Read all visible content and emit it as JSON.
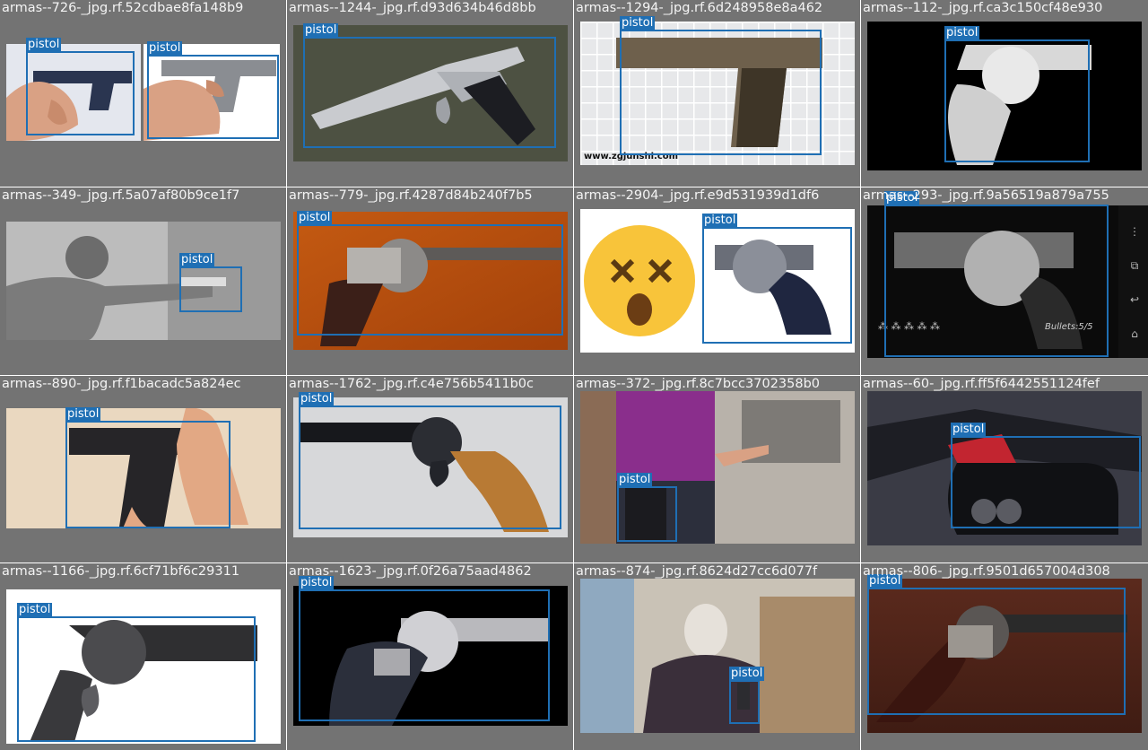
{
  "colors": {
    "tile_background": "#737373",
    "bbox": "#1f6fb4",
    "label_text": "#ffffff",
    "title_text": "#f4f4f4"
  },
  "tiles": [
    {
      "title": "armas--726-_jpg.rf.52cdbae8fa148b9",
      "labels": [
        "pistol",
        "pistol"
      ]
    },
    {
      "title": "armas--1244-_jpg.rf.d93d634b46d8bb",
      "labels": [
        "pistol"
      ]
    },
    {
      "title": "armas--1294-_jpg.rf.6d248958e8a462",
      "labels": [
        "pistol"
      ],
      "watermark": "www.zgjunshi.com"
    },
    {
      "title": "armas--112-_jpg.rf.ca3c150cf48e930",
      "labels": [
        "pistol"
      ]
    },
    {
      "title": "armas--349-_jpg.rf.5a07af80b9ce1f7",
      "labels": [
        "pistol"
      ]
    },
    {
      "title": "armas--779-_jpg.rf.4287d84b240f7b5",
      "labels": [
        "pistol"
      ]
    },
    {
      "title": "armas--2904-_jpg.rf.e9d531939d1df6",
      "labels": [
        "pistol"
      ]
    },
    {
      "title": "armas--293-_jpg.rf.9a56519a879a755",
      "labels": [
        "pistol"
      ],
      "hud_text": "Bullets:5/5"
    },
    {
      "title": "armas--890-_jpg.rf.f1bacadc5a824ec",
      "labels": [
        "pistol"
      ]
    },
    {
      "title": "armas--1762-_jpg.rf.c4e756b5411b0c",
      "labels": [
        "pistol"
      ]
    },
    {
      "title": "armas--372-_jpg.rf.8c7bcc3702358b0",
      "labels": [
        "pistol"
      ]
    },
    {
      "title": "armas--60-_jpg.rf.ff5f6442551124fef",
      "labels": [
        "pistol"
      ]
    },
    {
      "title": "armas--1166-_jpg.rf.6cf71bf6c29311",
      "labels": [
        "pistol"
      ]
    },
    {
      "title": "armas--1623-_jpg.rf.0f26a75aad4862",
      "labels": [
        "pistol"
      ]
    },
    {
      "title": "armas--874-_jpg.rf.8624d27cc6d077f",
      "labels": [
        "pistol"
      ]
    },
    {
      "title": "armas--806-_jpg.rf.9501d657004d308",
      "labels": [
        "pistol"
      ]
    }
  ]
}
